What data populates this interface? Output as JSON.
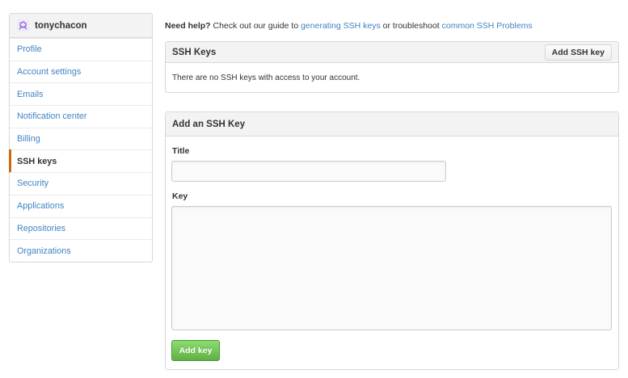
{
  "sidebar": {
    "username": "tonychacon",
    "items": [
      {
        "label": "Profile"
      },
      {
        "label": "Account settings"
      },
      {
        "label": "Emails"
      },
      {
        "label": "Notification center"
      },
      {
        "label": "Billing"
      },
      {
        "label": "SSH keys",
        "active": true
      },
      {
        "label": "Security"
      },
      {
        "label": "Applications"
      },
      {
        "label": "Repositories"
      },
      {
        "label": "Organizations"
      }
    ]
  },
  "help": {
    "prefix": "Need help?",
    "text1": " Check out our guide to ",
    "link1": "generating SSH keys",
    "text2": " or troubleshoot ",
    "link2": "common SSH Problems"
  },
  "ssh_keys": {
    "title": "SSH Keys",
    "add_button": "Add SSH key",
    "empty_message": "There are no SSH keys with access to your account."
  },
  "add_key": {
    "title": "Add an SSH Key",
    "title_label": "Title",
    "title_value": "",
    "key_label": "Key",
    "key_value": "",
    "submit": "Add key"
  },
  "colors": {
    "link": "#4183c4",
    "active_indicator": "#d26911",
    "submit_green": "#6cc644"
  }
}
